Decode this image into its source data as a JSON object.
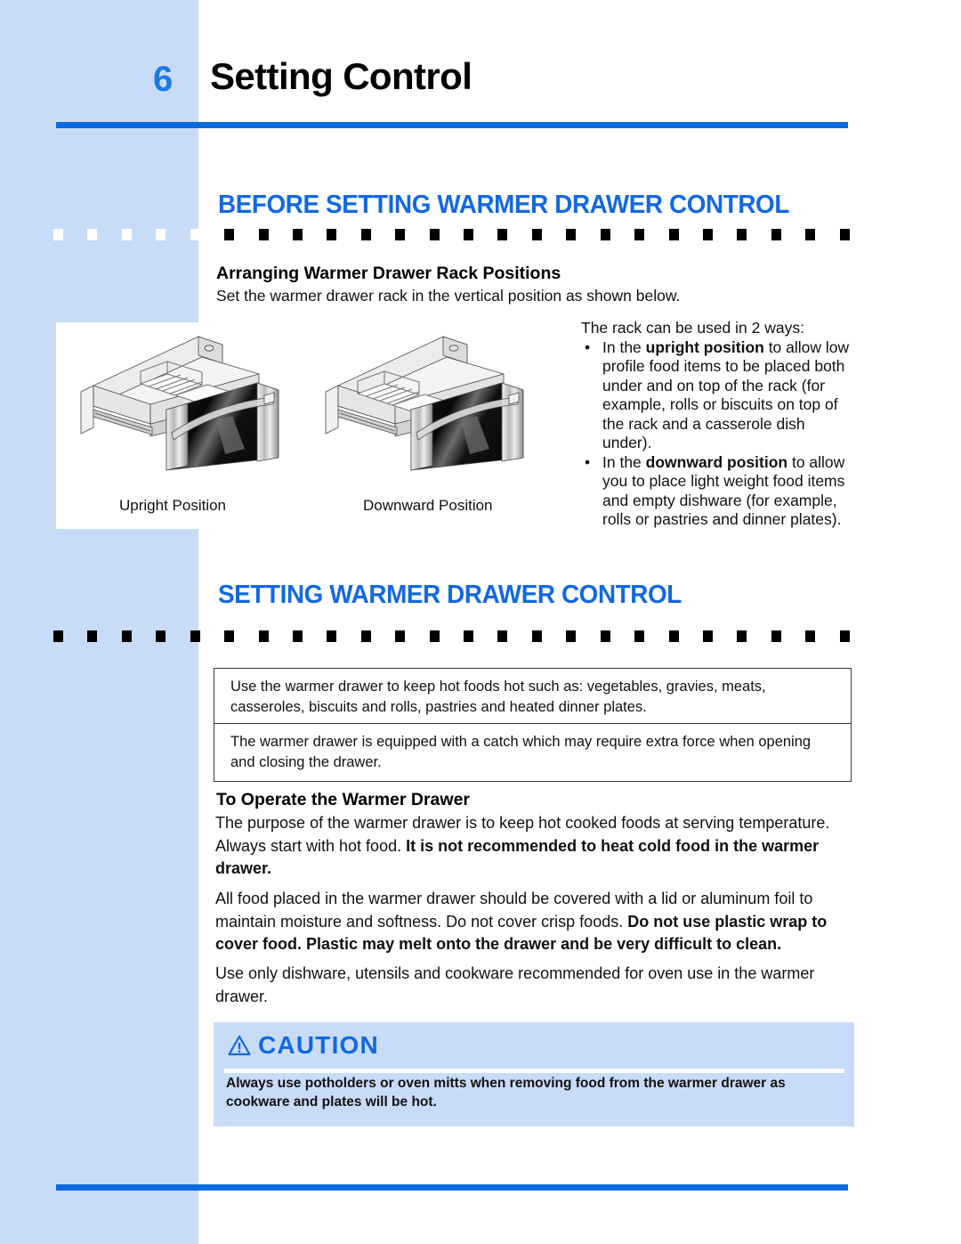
{
  "page": {
    "number": "6",
    "title": "Setting Control"
  },
  "colors": {
    "accent_blue": "#1268e0",
    "rule_blue": "#0b6ae0",
    "band_blue": "#c9dcf7"
  },
  "sections": {
    "before": {
      "heading": "BEFORE SETTING WARMER DRAWER CONTROL",
      "sub_heading": "Arranging Warmer Drawer Rack Positions",
      "intro": "Set the warmer drawer rack in the vertical position as shown below.",
      "figures": [
        {
          "caption": "Upright Position"
        },
        {
          "caption": "Downward Position"
        }
      ],
      "rack_ways": {
        "intro": "The rack can be used in 2 ways:",
        "bullet_glyph": "•",
        "items": [
          {
            "lead": "In the ",
            "bold": "upright position",
            "rest": " to allow low profile food items to be placed both under and on top of the rack (for example, rolls or biscuits on top of the rack and a casserole dish under)."
          },
          {
            "lead": "In the ",
            "bold": "downward position",
            "rest": " to allow you to place light weight food items and empty dishware (for example, rolls or pastries and dinner plates)."
          }
        ]
      }
    },
    "setting": {
      "heading": "SETTING WARMER DRAWER CONTROL",
      "notes": [
        "Use the warmer drawer to keep hot foods hot such as: vegetables, gravies, meats, casseroles, biscuits and rolls, pastries and heated dinner plates.",
        "The warmer drawer is equipped with a catch which may require extra force when opening and closing the drawer."
      ],
      "sub_heading": "To Operate the Warmer Drawer",
      "paragraphs": [
        {
          "plain_1": "The purpose of the warmer drawer is to keep hot cooked foods at serving temperature. Always start with hot food. ",
          "bold_1": "It is not recommended to heat cold food in the warmer drawer.",
          "plain_2": ""
        },
        {
          "plain_1": "All food placed in the warmer drawer should be covered with a lid or aluminum foil to maintain moisture and softness. Do not cover crisp foods. ",
          "bold_1": "Do not use plastic wrap to cover food. Plastic may melt onto the drawer and be very difficult to clean.",
          "plain_2": ""
        },
        {
          "plain_1": "Use only dishware, utensils and cookware recommended for oven use in the warmer drawer.",
          "bold_1": "",
          "plain_2": ""
        }
      ],
      "caution": {
        "icon": "warning-triangle-icon",
        "title": "CAUTION",
        "text": "Always use potholders or oven mitts when removing food from the warmer drawer as cookware and plates will be hot."
      }
    }
  },
  "dividers": {
    "square_count": 24,
    "squares_on_band": 5
  }
}
